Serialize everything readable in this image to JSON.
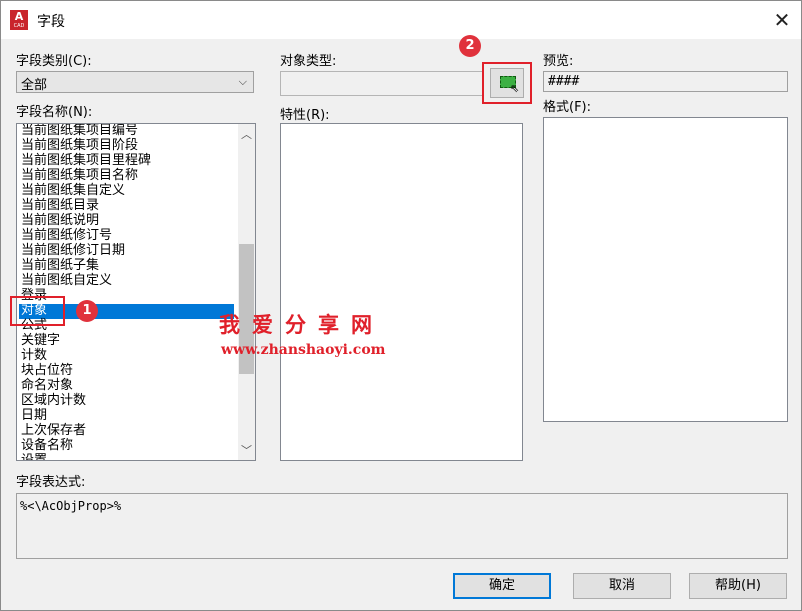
{
  "window": {
    "title": "字段",
    "close_glyph": "✕",
    "app_icon_letter": "A",
    "app_icon_sub": "CAD"
  },
  "field_category": {
    "label": "字段类别(C):",
    "value": "全部"
  },
  "field_names": {
    "label": "字段名称(N):",
    "items": [
      "当前图纸集项目编号",
      "当前图纸集项目阶段",
      "当前图纸集项目里程碑",
      "当前图纸集项目名称",
      "当前图纸集自定义",
      "当前图纸目录",
      "当前图纸说明",
      "当前图纸修订号",
      "当前图纸修订日期",
      "当前图纸子集",
      "当前图纸自定义",
      "登录",
      "对象",
      "公式",
      "关键字",
      "计数",
      "块占位符",
      "命名对象",
      "区域内计数",
      "日期",
      "上次保存者",
      "设备名称",
      "设置"
    ],
    "selected": "对象"
  },
  "object_type": {
    "label": "对象类型:",
    "value": ""
  },
  "properties": {
    "label": "特性(R):"
  },
  "preview": {
    "label": "预览:",
    "value": "####"
  },
  "format": {
    "label": "格式(F):"
  },
  "expression": {
    "label": "字段表达式:",
    "value": "%<\\AcObjProp>%"
  },
  "buttons": {
    "ok": "确定",
    "cancel": "取消",
    "help": "帮助(H)"
  },
  "annotations": {
    "badge1": "1",
    "badge2": "2",
    "highlight_color": "#e0202a"
  },
  "watermark": {
    "title": "我爱分享网",
    "url": "www.zhanshaoyi.com"
  },
  "colors": {
    "selection": "#0078d7",
    "pick_icon": "#3cb043"
  },
  "icons": {
    "close": "close-icon",
    "dropdown": "chevron-down-icon",
    "pick": "select-object-icon",
    "scroll_up": "scroll-up-icon",
    "scroll_down": "scroll-down-icon"
  }
}
